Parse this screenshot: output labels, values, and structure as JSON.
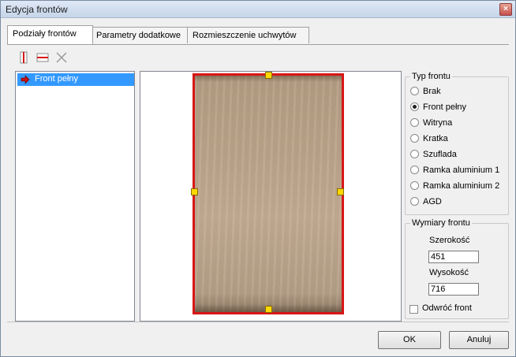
{
  "window": {
    "title": "Edycja frontów",
    "close_glyph": "×"
  },
  "tabs": [
    {
      "label": "Podziały frontów",
      "active": true
    },
    {
      "label": "Parametry dodatkowe",
      "active": false
    },
    {
      "label": "Rozmieszczenie uchwytów",
      "active": false
    }
  ],
  "toolbar": {
    "icons": [
      "vertical-split-icon",
      "horizontal-split-icon",
      "delete-division-icon"
    ]
  },
  "list": {
    "items": [
      {
        "label": "Front pełny",
        "selected": true,
        "icon": "red-arrow-icon"
      }
    ]
  },
  "typ_frontu": {
    "legend": "Typ frontu",
    "options": [
      {
        "label": "Brak",
        "checked": false
      },
      {
        "label": "Front pełny",
        "checked": true
      },
      {
        "label": "Witryna",
        "checked": false
      },
      {
        "label": "Kratka",
        "checked": false
      },
      {
        "label": "Szuflada",
        "checked": false
      },
      {
        "label": "Ramka aluminium 1",
        "checked": false
      },
      {
        "label": "Ramka aluminium 2",
        "checked": false
      },
      {
        "label": "AGD",
        "checked": false
      }
    ]
  },
  "wymiary": {
    "legend": "Wymiary frontu",
    "width_label": "Szerokość",
    "width_value": "451",
    "height_label": "Wysokość",
    "height_value": "716",
    "flip_label": "Odwróć front",
    "flip_checked": false
  },
  "buttons": {
    "ok": "OK",
    "cancel": "Anuluj"
  },
  "colors": {
    "selection": "#3399ff",
    "front_border": "#d81616",
    "handle": "#ffd800",
    "wood": "#bba48a"
  }
}
